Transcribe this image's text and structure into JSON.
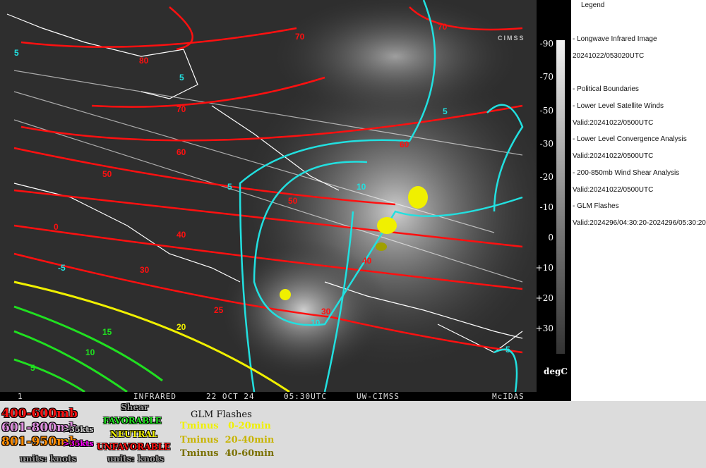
{
  "colors": {
    "red": "#ff1010",
    "cyan": "#22e0e0",
    "yellow": "#f0f000",
    "green": "#20e020",
    "orange": "#ff8c00",
    "pink": "#e090e0",
    "white": "#ffffff"
  },
  "map": {
    "red_labels": [
      "80",
      "70",
      "70",
      "70",
      "60",
      "60",
      "50",
      "50",
      "40",
      "40",
      "30",
      "30",
      "25",
      "0"
    ],
    "cyan_labels": [
      "5",
      "5",
      "5",
      "5",
      "10",
      "10",
      "5",
      "-5"
    ],
    "yellow_labels": [
      "20"
    ],
    "green_labels": [
      "15",
      "10",
      "5"
    ],
    "logo": "CIMSS"
  },
  "statusbar": {
    "frame": "1",
    "product": "INFRARED",
    "date": "22 OCT 24",
    "time": "05:30UTC",
    "source": "UW-CIMSS",
    "software": "McIDAS"
  },
  "colorbar": {
    "ticks": [
      "-90",
      "-70",
      "-50",
      "-30",
      "-20",
      "-10",
      "0",
      "+10",
      "+20",
      "+30"
    ],
    "unit": "degC"
  },
  "legend": {
    "title": "Legend",
    "lines": [
      "-  Longwave Infrared Image",
      "20241022/053020UTC",
      "-  Political Boundaries",
      "-  Lower Level Satellite Winds",
      "Valid:20241022/0500UTC",
      "-  Lower Level Convergence Analysis",
      "Valid:20241022/0500UTC",
      "-  200-850mb Wind Shear Analysis",
      "Valid:20241022/0500UTC",
      "-  GLM Flashes",
      "Valid:2024296/04:30:20-2024296/05:30:20"
    ]
  },
  "bottom": {
    "winds": {
      "l1": "400-600mb",
      "l2": "601-800mb",
      "l2b": ">35kts",
      "l3": "801-950mb",
      "l3b": ">35kts",
      "units": "units: knots"
    },
    "shear": {
      "title": "Shear",
      "favorable": "FAVORABLE",
      "neutral": "NEUTRAL",
      "unfavorable": "UNFAVORABLE",
      "units": "units: knots"
    },
    "glm": {
      "title": "GLM Flashes",
      "t1": "Tminus   0-20min",
      "t2": "Tminus  20-40min",
      "t3": "Tminus  40-60min"
    }
  }
}
